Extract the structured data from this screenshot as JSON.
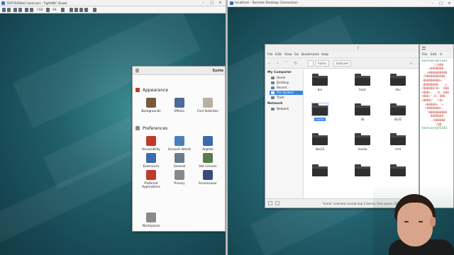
{
  "vnc": {
    "title": "TEXTOURBol2 (testuser) - TightVNC Viewer",
    "toolbar": {
      "ctrl_alt_del": "CAD",
      "alt": "Alt"
    },
    "settings_window": {
      "title": "Syste",
      "sections": [
        {
          "heading": "Appearance",
          "items": [
            {
              "label": "Backgrounds",
              "icon": "backgrounds-icon",
              "color": "#7a5a3a"
            },
            {
              "label": "Effects",
              "icon": "effects-icon",
              "color": "#4a6a9a"
            },
            {
              "label": "Font Selection",
              "icon": "font-icon",
              "color": "#b8b0a0"
            }
          ]
        },
        {
          "heading": "Preferences",
          "items": [
            {
              "label": "Accessibility",
              "icon": "accessibility-icon",
              "color": "#c0392b"
            },
            {
              "label": "Account details",
              "icon": "account-icon",
              "color": "#4a7fb5"
            },
            {
              "label": "Applets",
              "icon": "applets-icon",
              "color": "#3a6ab0"
            },
            {
              "label": "Extensions",
              "icon": "extensions-icon",
              "color": "#3a6ab0"
            },
            {
              "label": "General",
              "icon": "general-icon",
              "color": "#6a7a8a"
            },
            {
              "label": "Hot Corners",
              "icon": "hot-corners-icon",
              "color": "#5a7a4a"
            },
            {
              "label": "Preferred Applications",
              "icon": "preferred-apps-icon",
              "color": "#c0392b"
            },
            {
              "label": "Privacy",
              "icon": "privacy-icon",
              "color": "#8a8a8a"
            },
            {
              "label": "Screensaver",
              "icon": "screensaver-icon",
              "color": "#3a4a7a"
            },
            {
              "label": "Workspaces",
              "icon": "workspaces-icon",
              "color": "#8a8a8a"
            }
          ]
        }
      ]
    }
  },
  "rdp": {
    "title": "localhost - Remote Desktop Connection",
    "file_manager": {
      "title": "/",
      "menu": [
        "File",
        "Edit",
        "View",
        "Go",
        "Bookmarks",
        "Help"
      ],
      "breadcrumbs": [
        "home",
        "testuser"
      ],
      "sidebar": {
        "my_computer": "My Computer",
        "items": [
          "Home",
          "Desktop",
          "Recent",
          "File System",
          "Trash"
        ],
        "network": "Network",
        "network_items": [
          "Network"
        ]
      },
      "folders": [
        "bin",
        "boot",
        "dev",
        "home",
        "lib",
        "lib32",
        "libx32",
        "media",
        "mnt",
        "",
        "",
        ""
      ],
      "status": "\"home\" selected (containing 2 items), Free space: 215.8 GB"
    },
    "terminal": {
      "menu": [
        "File",
        "Edit",
        "V"
      ],
      "lines": [
        "testuser@75143",
        "      '/(000",
        "   .+0000000",
        "  .+0000000000",
        " /00000000000",
        ".000000000+. '",
        ".00000000:  .+",
        "/000000/0+  000",
        "+000+.  .0: 000",
        "+000/'.0: 000",
        "/0000/' '+0+",
        "  +00000+ '+",
        " '/0000000+.",
        "   :0000000000",
        "    .0000000",
        "     ./000000",
        "       '/00",
        "",
        "",
        "",
        "",
        "testuser@75143"
      ]
    }
  }
}
